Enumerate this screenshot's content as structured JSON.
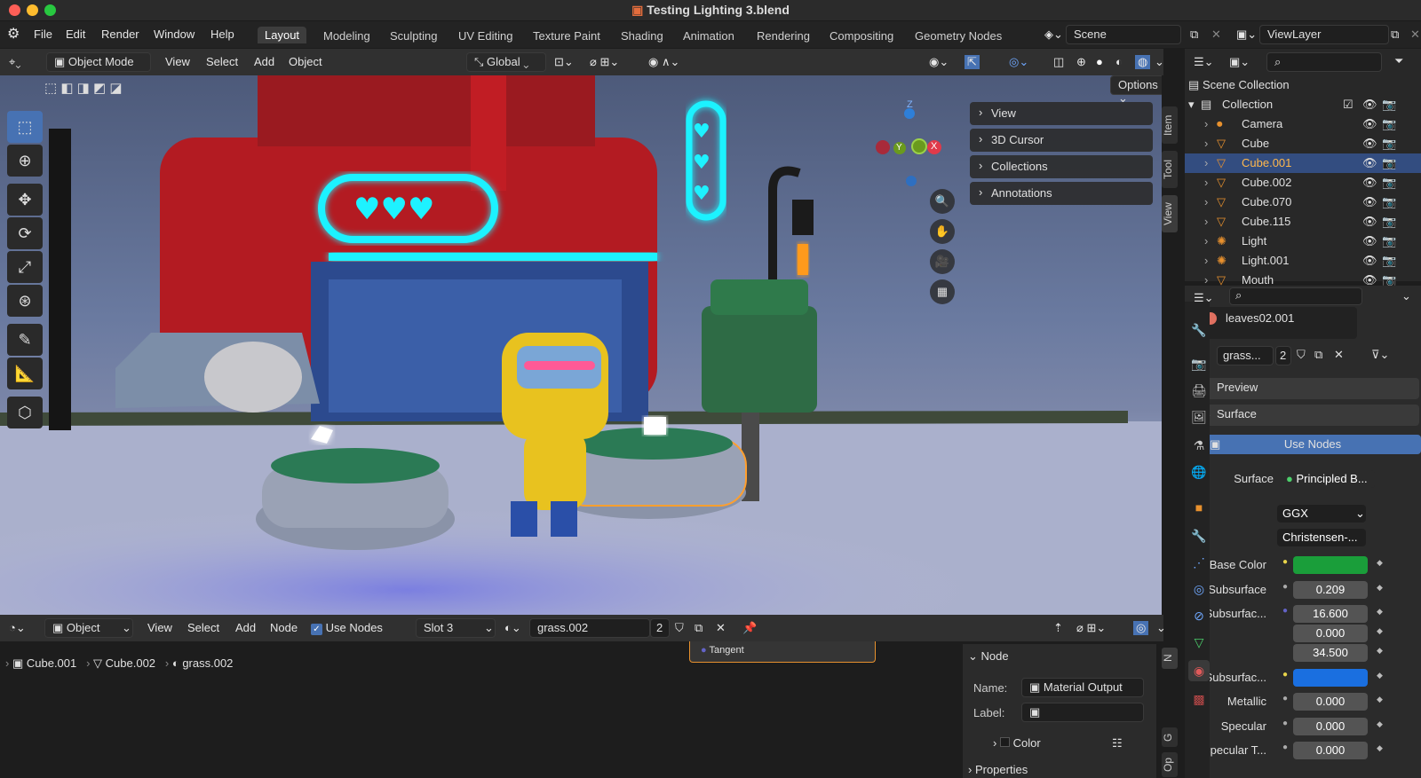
{
  "window": {
    "title": "Testing Lighting 3.blend"
  },
  "menu": [
    "File",
    "Edit",
    "Render",
    "Window",
    "Help"
  ],
  "workspaces": [
    "Layout",
    "Modeling",
    "Sculpting",
    "UV Editing",
    "Texture Paint",
    "Shading",
    "Animation",
    "Rendering",
    "Compositing",
    "Geometry Nodes"
  ],
  "scene": "Scene",
  "view_layer": "ViewLayer",
  "viewport_header": {
    "mode": "Object Mode",
    "menus": [
      "View",
      "Select",
      "Add",
      "Object"
    ],
    "transform": "Global",
    "options": "Options"
  },
  "npanel": [
    "View",
    "3D Cursor",
    "Collections",
    "Annotations"
  ],
  "side_tabs": [
    "Item",
    "Tool",
    "View"
  ],
  "gizmo": {
    "z": "Z",
    "y": "Y",
    "x": "X"
  },
  "outliner": {
    "root": "Scene Collection",
    "collection": "Collection",
    "items": [
      "Camera",
      "Cube",
      "Cube.001",
      "Cube.002",
      "Cube.070",
      "Cube.115",
      "Light",
      "Light.001",
      "Mouth"
    ],
    "selected": "Cube.001"
  },
  "properties": {
    "material_slot": "leaves02.001",
    "material": "grass...",
    "users": "2",
    "preview": "Preview",
    "surface_panel": "Surface",
    "use_nodes": "Use Nodes",
    "surface_label": "Surface",
    "surface_value": "Principled B...",
    "distribution": "GGX",
    "sss_method": "Christensen-...",
    "rows": [
      {
        "label": "Base Color",
        "value": "",
        "color": "#1a9e3a"
      },
      {
        "label": "Subsurface",
        "value": "0.209"
      },
      {
        "label": "Subsurfac...",
        "value": "16.600"
      },
      {
        "label": "",
        "value": "0.000"
      },
      {
        "label": "",
        "value": "34.500"
      },
      {
        "label": "Subsurfac...",
        "value": "",
        "color": "#1a6fe0"
      },
      {
        "label": "Metallic",
        "value": "0.000"
      },
      {
        "label": "Specular",
        "value": "0.000"
      },
      {
        "label": "Specular T...",
        "value": "0.000"
      }
    ]
  },
  "node_header": {
    "editor": "Object",
    "menus": [
      "View",
      "Select",
      "Add",
      "Node"
    ],
    "use_nodes": "Use Nodes",
    "slot": "Slot 3",
    "material": "grass.002",
    "users": "2"
  },
  "breadcrumb": [
    "Cube.001",
    "Cube.002",
    "grass.002"
  ],
  "node": {
    "socket": "Tangent"
  },
  "node_panel": {
    "title": "Node",
    "name_label": "Name:",
    "name_value": "Material Output",
    "label_label": "Label:",
    "color": "Color",
    "properties": "Properties"
  },
  "node_side_tabs": [
    "N",
    "G",
    "Op"
  ]
}
